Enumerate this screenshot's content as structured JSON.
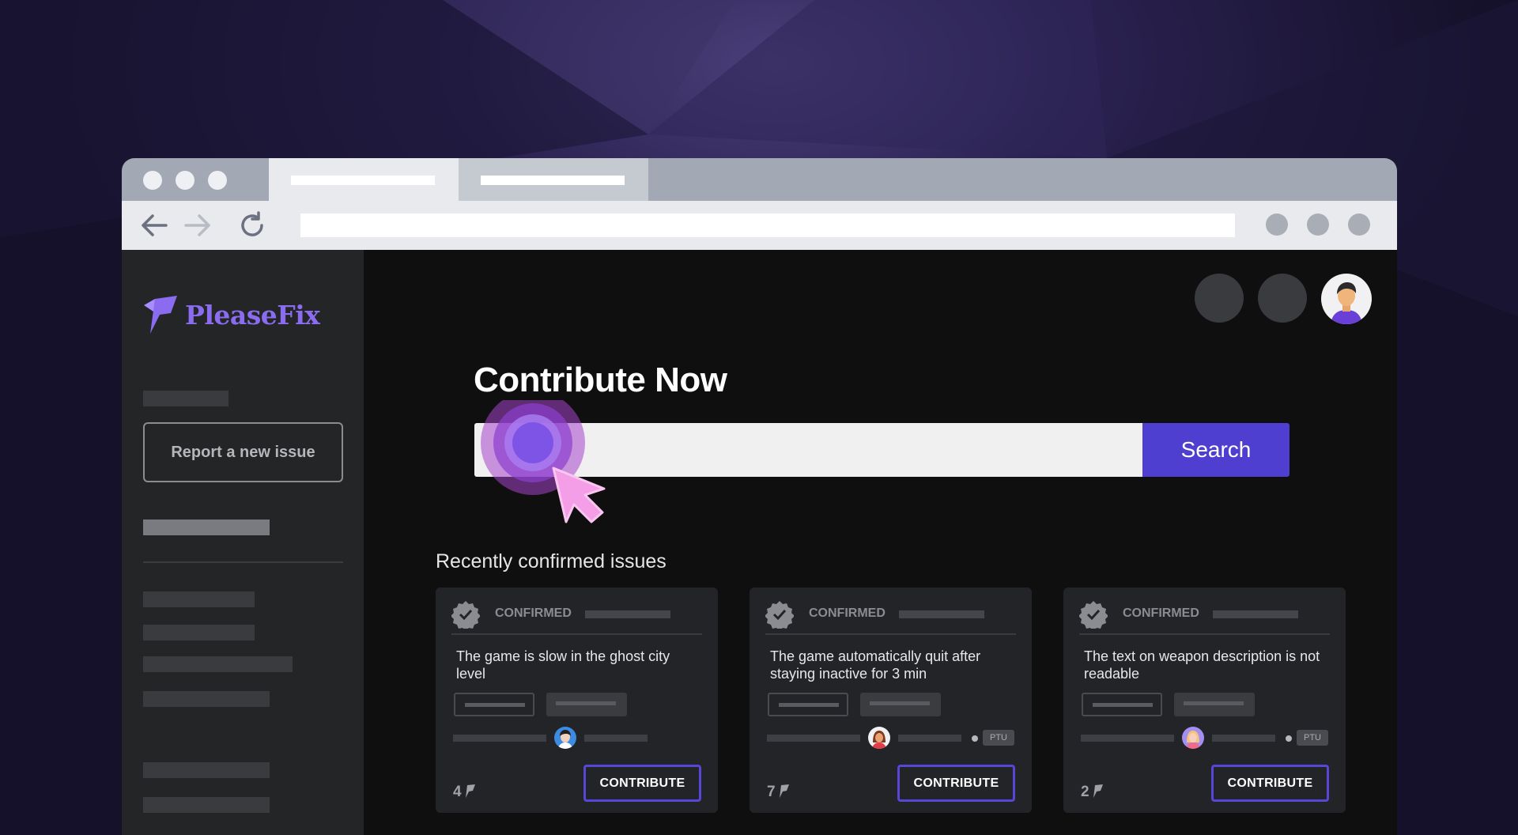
{
  "brand": {
    "name": "PleaseFix",
    "accent": "#8b6cf0"
  },
  "colors": {
    "primary": "#4f3fd0",
    "contribute_border": "#5846d6",
    "card_bg": "#232427"
  },
  "sidebar": {
    "report_button": "Report a new issue"
  },
  "main": {
    "title": "Contribute Now",
    "search": {
      "button": "Search",
      "value": "",
      "placeholder": ""
    },
    "section_title": "Recently confirmed issues"
  },
  "cards": [
    {
      "status": "CONFIRMED",
      "title": "The game is slow in the ghost city level",
      "count": "4",
      "button": "CONTRIBUTE",
      "tag": ""
    },
    {
      "status": "CONFIRMED",
      "title": "The game automatically quit after staying inactive for 3 min",
      "count": "7",
      "button": "CONTRIBUTE",
      "tag": "PTU"
    },
    {
      "status": "CONFIRMED",
      "title": "The text on weapon description is not readable",
      "count": "2",
      "button": "CONTRIBUTE",
      "tag": "PTU"
    }
  ],
  "icons": [
    "back-arrow-icon",
    "forward-arrow-icon",
    "reload-icon",
    "verified-badge-icon",
    "pleasefix-flag-icon",
    "pointer-cursor-icon"
  ]
}
